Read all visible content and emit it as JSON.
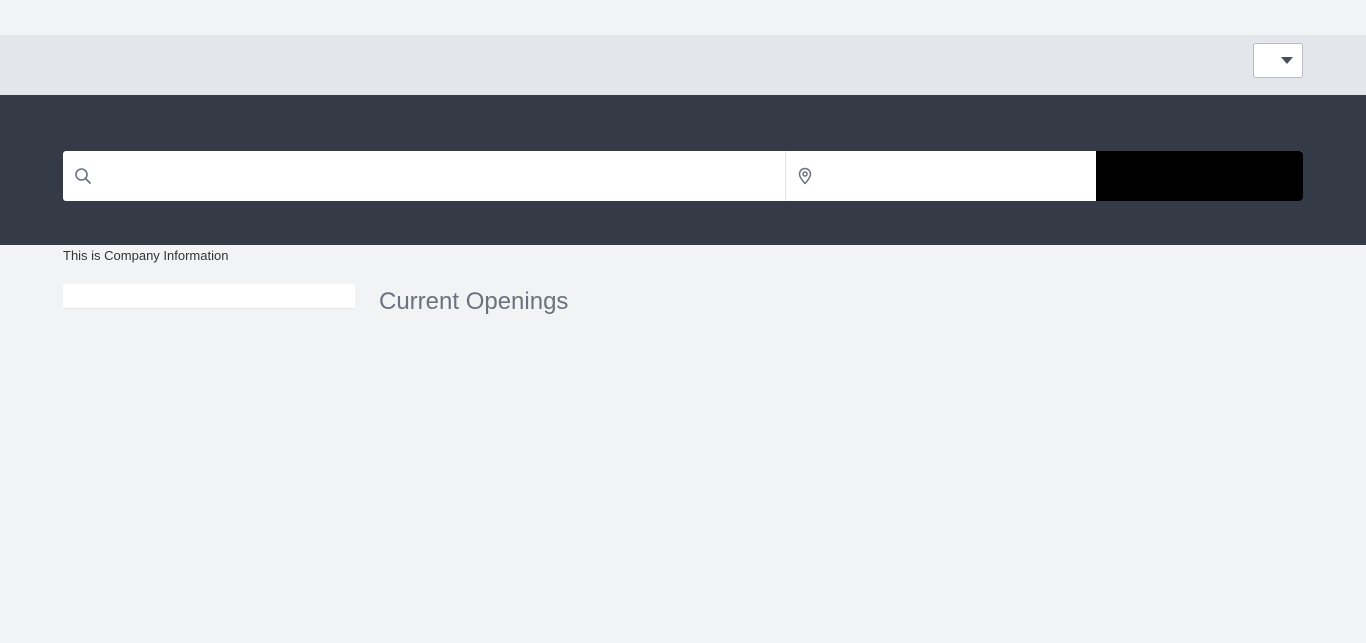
{
  "header": {
    "language_select": {
      "selected_value": "",
      "icon": "chevron-down-icon"
    }
  },
  "search": {
    "keyword": {
      "icon": "search-icon",
      "value": "",
      "placeholder": ""
    },
    "location": {
      "icon": "map-pin-icon",
      "value": "",
      "placeholder": ""
    },
    "button_label": "",
    "button_color": "#000000"
  },
  "main": {
    "company_info": "This is Company Information",
    "openings_title": "Current Openings"
  },
  "colors": {
    "page_background": "#f2f3f5",
    "header_background": "#e3e6ea",
    "hero_background": "#343a46",
    "title_color": "#6b7280"
  }
}
